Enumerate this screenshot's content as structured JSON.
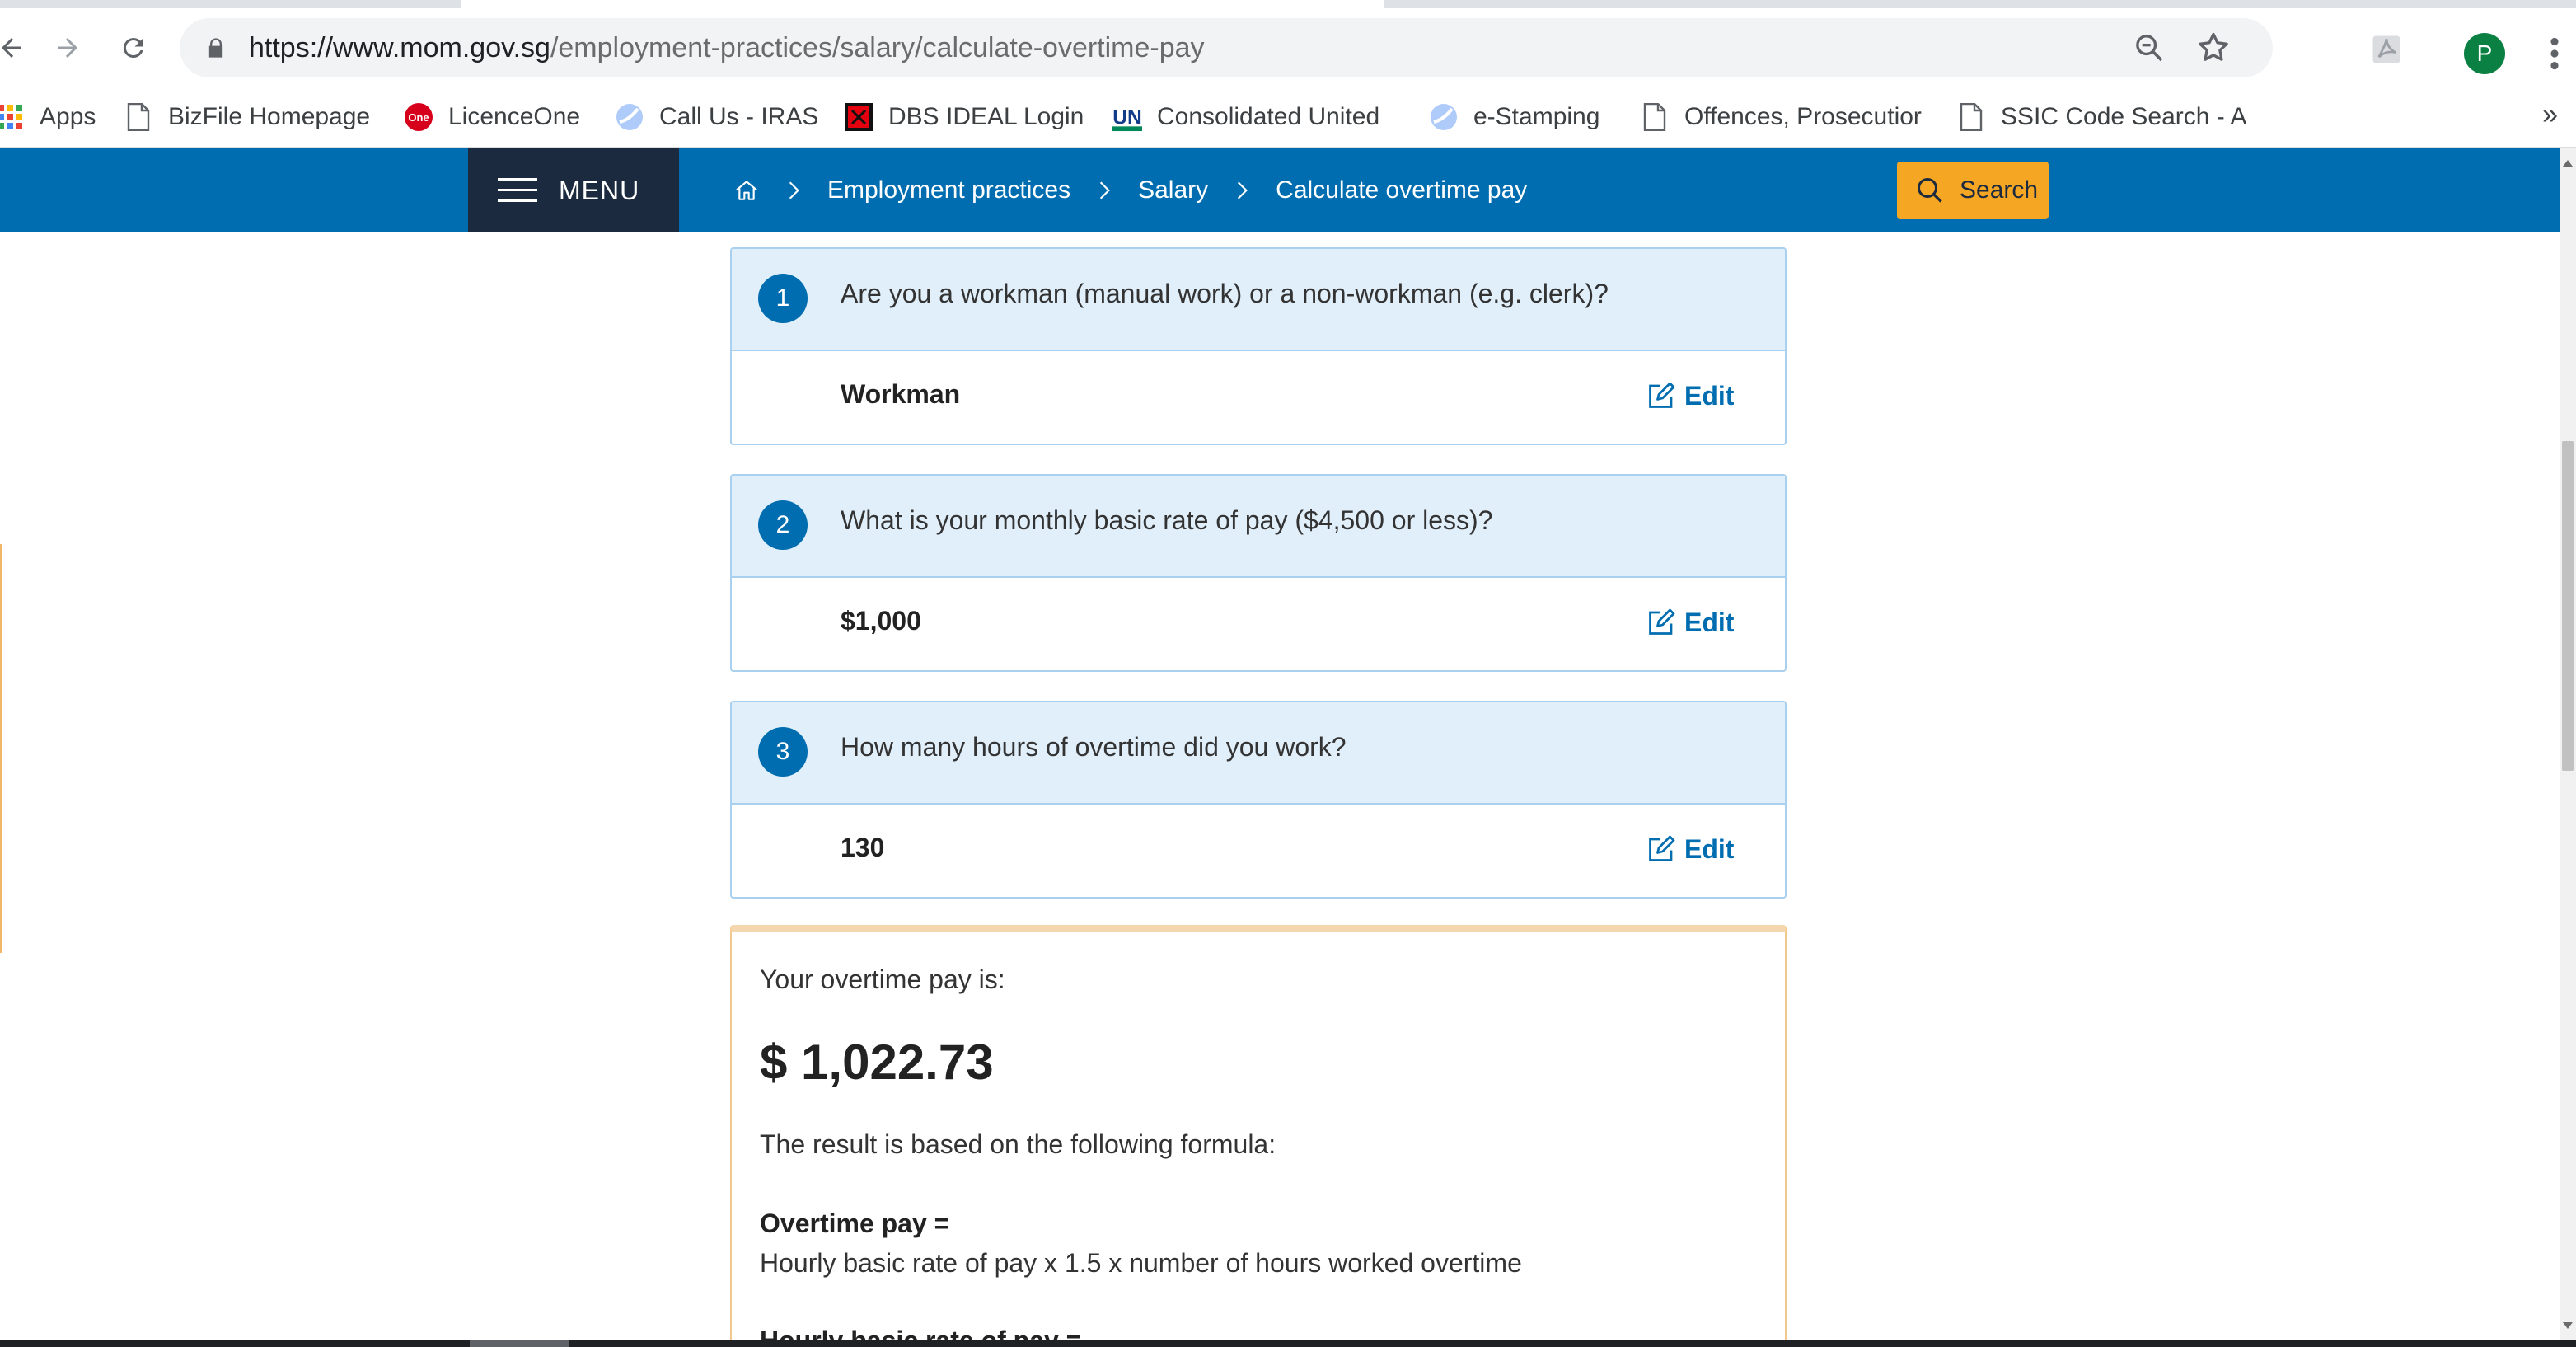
{
  "browser": {
    "url_host": "https://www.mom.gov.sg",
    "url_path": "/employment-practices/salary/calculate-overtime-pay",
    "profile_initial": "P",
    "bookmarks": [
      {
        "label": "Apps",
        "icon": "apps-grid-icon"
      },
      {
        "label": "BizFile Homepage",
        "icon": "page-icon"
      },
      {
        "label": "LicenceOne",
        "icon": "licenceone-icon"
      },
      {
        "label": "Call Us - IRAS",
        "icon": "globe-icon"
      },
      {
        "label": "DBS IDEAL Login",
        "icon": "dbs-icon"
      },
      {
        "label": "Consolidated United",
        "icon": "un-icon"
      },
      {
        "label": "e-Stamping",
        "icon": "globe-icon"
      },
      {
        "label": "Offences, Prosecutior",
        "icon": "page-icon"
      },
      {
        "label": "SSIC Code Search - A",
        "icon": "page-icon"
      }
    ],
    "more_bookmarks": "»"
  },
  "header": {
    "menu_label": "MENU",
    "breadcrumb": [
      "Employment practices",
      "Salary",
      "Calculate overtime pay"
    ],
    "search_label": "Search"
  },
  "questions": [
    {
      "number": "1",
      "question": "Are you a workman (manual work) or a non-workman (e.g. clerk)?",
      "answer": "Workman",
      "edit_label": "Edit"
    },
    {
      "number": "2",
      "question": "What is your monthly basic rate of pay ($4,500 or less)?",
      "answer": "$1,000",
      "edit_label": "Edit"
    },
    {
      "number": "3",
      "question": "How many hours of overtime did you work?",
      "answer": "130",
      "edit_label": "Edit"
    }
  ],
  "result": {
    "intro": "Your overtime pay is:",
    "amount": "$ 1,022.73",
    "basis": "The result is based on the following formula:",
    "formula_title": "Overtime pay =",
    "formula_body": "Hourly basic rate of pay x 1.5 x number of hours worked overtime",
    "formula_title_2": "Hourly basic rate of pay ="
  },
  "colors": {
    "brand_blue": "#006db0",
    "navy": "#1b2a3e",
    "search_orange": "#f5a623",
    "question_bg": "#e1effb"
  }
}
